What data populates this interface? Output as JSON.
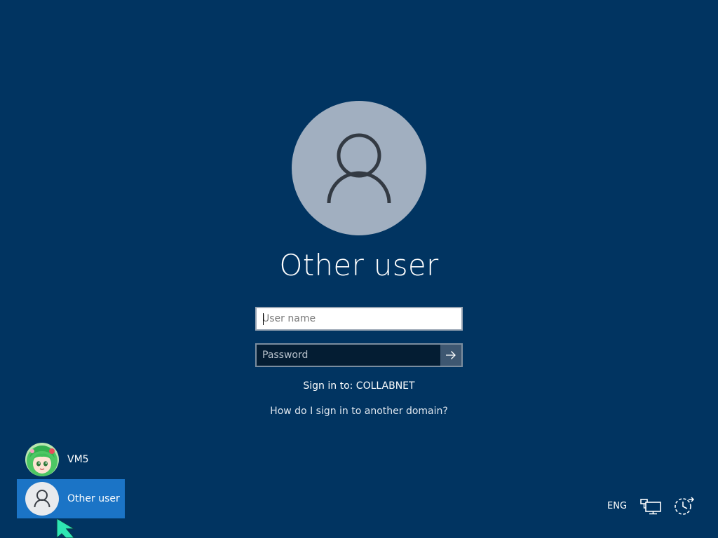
{
  "screen": {
    "type": "windows-sign-in",
    "background_color": "#013461"
  },
  "current_user": {
    "name": "Other user",
    "avatar_icon": "person-icon"
  },
  "username_field": {
    "placeholder": "User name",
    "value": ""
  },
  "password_field": {
    "placeholder": "Password",
    "value": "",
    "submit_icon": "arrow-right-icon"
  },
  "sign_in_target": "Sign in to: COLLABNET",
  "domain_help_link": "How do I sign in to another domain?",
  "user_list": [
    {
      "name": "VM5",
      "avatar": "anime-character-avatar",
      "selected": false
    },
    {
      "name": "Other user",
      "avatar": "person-icon",
      "selected": true,
      "highlight_color": "#1b74c6"
    }
  ],
  "tray": {
    "language": "ENG",
    "network_icon": "network-icon",
    "power_icon": "power-icon"
  }
}
